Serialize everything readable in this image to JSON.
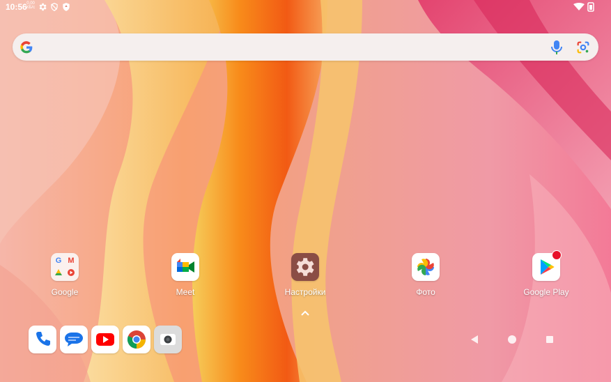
{
  "status_bar": {
    "time": "10:56",
    "speed_value": "0,00",
    "speed_unit": "КБ/с",
    "icons": [
      "gear-icon",
      "vpn-shield-icon",
      "security-shield-icon",
      "wifi-icon",
      "battery-icon"
    ]
  },
  "search": {
    "icons": [
      "google-g-icon",
      "microphone-icon",
      "google-lens-icon"
    ]
  },
  "home_apps": [
    {
      "label": "Google",
      "icon": "google-folder-icon"
    },
    {
      "label": "Meet",
      "icon": "meet-icon"
    },
    {
      "label": "Настройки",
      "icon": "settings-gear-icon"
    },
    {
      "label": "Фото",
      "icon": "photos-pinwheel-icon"
    },
    {
      "label": "Google Play",
      "icon": "play-store-icon",
      "badge": true
    }
  ],
  "dock": [
    "phone-icon",
    "messages-icon",
    "youtube-icon",
    "chrome-icon",
    "camera-icon"
  ],
  "nav": [
    "back-button",
    "home-button",
    "recents-button"
  ],
  "colors": {
    "wallpaper_orange": "#f7901e",
    "wallpaper_pink": "#e25c7c",
    "search_bg": "#f5efee",
    "badge": "#e8102a",
    "settings_icon_bg": "#8a4d45"
  }
}
